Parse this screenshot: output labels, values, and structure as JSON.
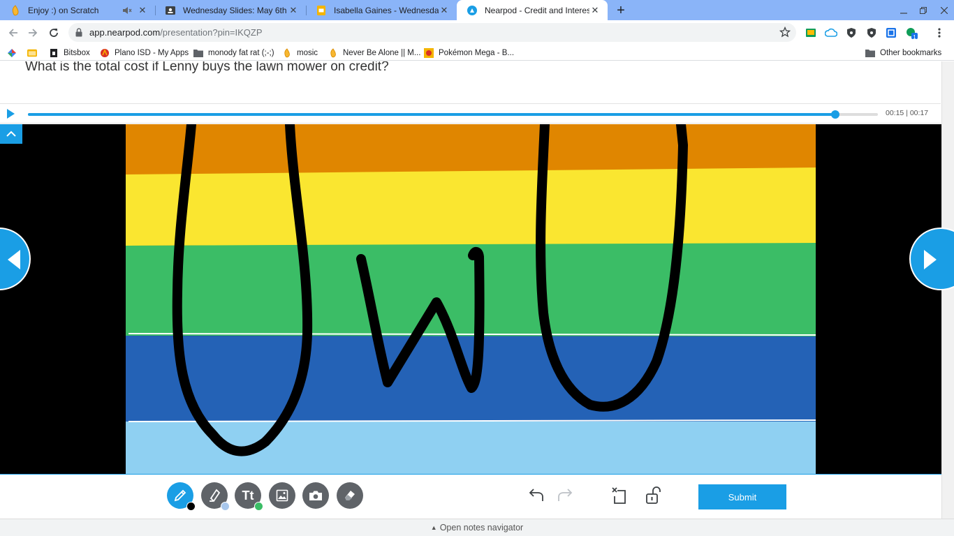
{
  "browser": {
    "tabs": [
      {
        "title": "Enjoy :) on Scratch",
        "icon": "scratch-icon",
        "muted": true,
        "active": false
      },
      {
        "title": "Wednesday Slides: May 6th",
        "icon": "classroom-icon",
        "active": false
      },
      {
        "title": "Isabella Gaines - Wednesday Slides",
        "icon": "slides-icon",
        "active": false
      },
      {
        "title": "Nearpod - Credit and Interest Pr",
        "icon": "nearpod-icon",
        "active": true
      }
    ],
    "url_host": "app.nearpod.com",
    "url_path": "/presentation?pin=IKQZP",
    "bookmarks": [
      {
        "label": "",
        "icon": "apps-icon"
      },
      {
        "label": "",
        "icon": "folder-icon"
      },
      {
        "label": "Bitsbox",
        "icon": "bitsbox-icon"
      },
      {
        "label": "Plano ISD - My Apps",
        "icon": "plano-icon"
      },
      {
        "label": "monody fat rat (;-;)",
        "icon": "folder-icon"
      },
      {
        "label": "mosic",
        "icon": "scratch-icon"
      },
      {
        "label": "Never Be Alone || M...",
        "icon": "scratch-icon"
      },
      {
        "label": "Pokémon Mega - B...",
        "icon": "pokemon-icon"
      }
    ],
    "other_bookmarks": "Other bookmarks",
    "extension_badge": "1"
  },
  "lesson": {
    "question": "What is the total cost if Lenny buys the lawn mower on credit?",
    "media": {
      "progress": 0.95,
      "time_current": "00:15",
      "time_separator": " | ",
      "time_total": "00:17"
    },
    "drawing": {
      "stripes": [
        "#e08600",
        "#fae630",
        "#3bbd66",
        "#2462b6",
        "#8fd0f2"
      ],
      "text_drawn": "UwU"
    },
    "toolbar": {
      "pen_color": "#000000",
      "highlighter_color": "#a8c7ec",
      "text_color": "#3bbd66",
      "submit_label": "Submit"
    },
    "notes_label": "Open notes navigator"
  },
  "colors": {
    "accent": "#1a9ee5",
    "tabstrip": "#8ab4f8"
  }
}
